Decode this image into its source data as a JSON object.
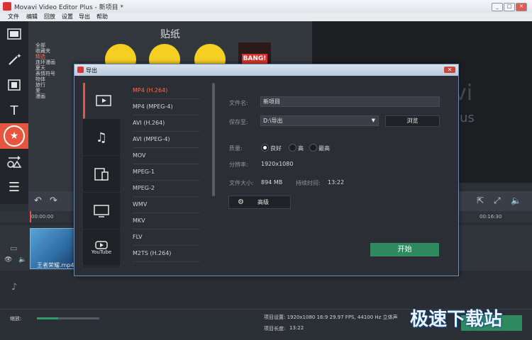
{
  "window": {
    "title": "Movavi Video Editor Plus - 新项目 *",
    "controls": [
      "_",
      "□",
      "✕"
    ]
  },
  "menu": [
    "文件",
    "编辑",
    "回放",
    "设置",
    "导出",
    "帮助"
  ],
  "left_tools": [
    {
      "icon": "film-icon"
    },
    {
      "icon": "magic-wand-icon"
    },
    {
      "icon": "filters-icon"
    },
    {
      "icon": "text-icon",
      "glyph": "T"
    },
    {
      "icon": "sticker-star-icon",
      "glyph": "★"
    },
    {
      "icon": "shapes-icon"
    },
    {
      "icon": "list-icon",
      "glyph": "☰"
    }
  ],
  "stickers": {
    "title": "贴纸",
    "categories": [
      "全部",
      "收藏夹",
      "精选",
      "连环漫画",
      "夏天",
      "表情符号",
      "物体",
      "旅行",
      "爱",
      "漫画"
    ],
    "selected_category": "精选",
    "bang_label": "BANG!"
  },
  "preview_watermark": {
    "line1": "vi",
    "line2": "us"
  },
  "timeline": {
    "time_marks": [
      "00:00:00",
      "00:16:30"
    ],
    "clip_name": "王者荣耀.mp4"
  },
  "bottom": {
    "zoom_label": "缩放:",
    "project_settings": "项目设置:  1920x1080 16:9 29.97 FPS, 44100 Hz 立体声",
    "project_length_label": "项目长度:",
    "project_length": "13:22"
  },
  "dialog": {
    "title": "导出",
    "tabs": [
      {
        "icon": "video-icon",
        "active": true
      },
      {
        "icon": "music-icon"
      },
      {
        "icon": "mobile-devices-icon"
      },
      {
        "icon": "tv-icon"
      },
      {
        "icon": "youtube-icon",
        "label": "YouTube"
      }
    ],
    "formats": [
      "MP4 (H.264)",
      "MP4 (MPEG-4)",
      "AVI (H.264)",
      "AVI (MPEG-4)",
      "MOV",
      "MPEG-1",
      "MPEG-2",
      "WMV",
      "MKV",
      "FLV",
      "M2TS (H.264)"
    ],
    "selected_format": "MP4 (H.264)",
    "filename_label": "文件名:",
    "filename": "新项目",
    "save_to_label": "保存至:",
    "save_to": "D:\\导出",
    "browse": "浏览",
    "quality_label": "质量:",
    "quality_options": [
      "良好",
      "高",
      "最高"
    ],
    "quality_selected": "良好",
    "resolution_label": "分辨率:",
    "resolution": "1920x1080",
    "filesize_label": "文件大小:",
    "filesize": "894 MB",
    "duration_label": "持续时间:",
    "duration": "13:22",
    "advanced": "高级",
    "start": "开始"
  },
  "site_watermark": "极速下载站",
  "colors": {
    "accent": "#e8553f",
    "start_green": "#2f8a5f",
    "selected_text": "#ff6a4a"
  }
}
